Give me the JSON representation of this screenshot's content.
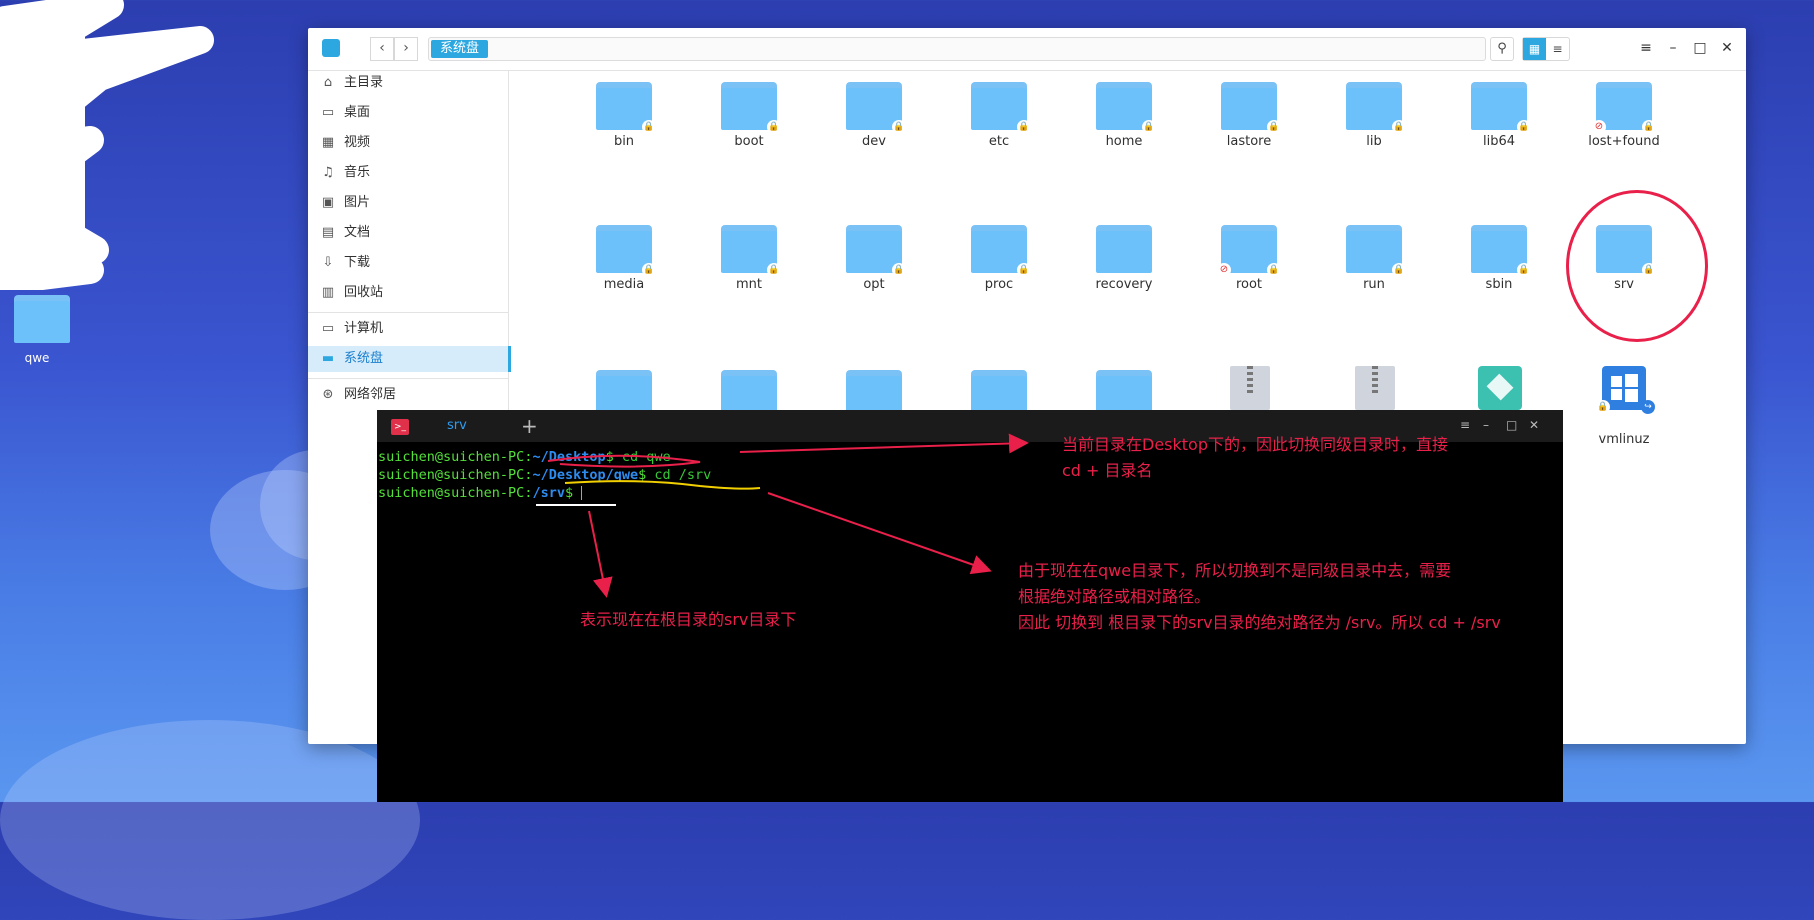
{
  "desktop": {
    "icon_label": "qwe"
  },
  "file_manager": {
    "breadcrumb": "系统盘",
    "sidebar": [
      {
        "label": "主目录",
        "icon": "home-icon"
      },
      {
        "label": "桌面",
        "icon": "desktop-icon"
      },
      {
        "label": "视频",
        "icon": "video-icon"
      },
      {
        "label": "音乐",
        "icon": "music-icon"
      },
      {
        "label": "图片",
        "icon": "picture-icon"
      },
      {
        "label": "文档",
        "icon": "document-icon"
      },
      {
        "label": "下载",
        "icon": "download-icon"
      },
      {
        "label": "回收站",
        "icon": "trash-icon"
      },
      {
        "label": "计算机",
        "icon": "computer-icon"
      },
      {
        "label": "系统盘",
        "icon": "disk-icon",
        "active": true
      },
      {
        "label": "网络邻居",
        "icon": "network-icon"
      }
    ],
    "folders_row1": [
      "bin",
      "boot",
      "dev",
      "etc",
      "home",
      "lastore",
      "lib",
      "lib64",
      "lost+found"
    ],
    "folders_row2": [
      "media",
      "mnt",
      "opt",
      "proc",
      "recovery",
      "root",
      "run",
      "sbin",
      "srv"
    ],
    "row3_visible_label": "vmlinuz"
  },
  "terminal": {
    "tab_title": "srv",
    "lines": [
      {
        "user": "suichen@suichen-PC",
        "path": "~/Desktop",
        "cmd": " cd qwe"
      },
      {
        "user": "suichen@suichen-PC",
        "path": "~/Desktop/qwe",
        "cmd": " cd /srv"
      },
      {
        "user": "suichen@suichen-PC",
        "path": "/srv",
        "cmd": " "
      }
    ]
  },
  "annotations": {
    "note1_line1": "当前目录在Desktop下的，因此切换同级目录时，直接",
    "note1_line2": "cd + 目录名",
    "note2_line1": "由于现在在qwe目录下，所以切换到不是同级目录中去，需要",
    "note2_line2": "根据绝对路径或相对路径。",
    "note2_line3": "因此 切换到 根目录下的srv目录的绝对路径为 /srv。所以 cd + /srv",
    "note3": "表示现在在根目录的srv目录下",
    "color": "#e8204a"
  }
}
